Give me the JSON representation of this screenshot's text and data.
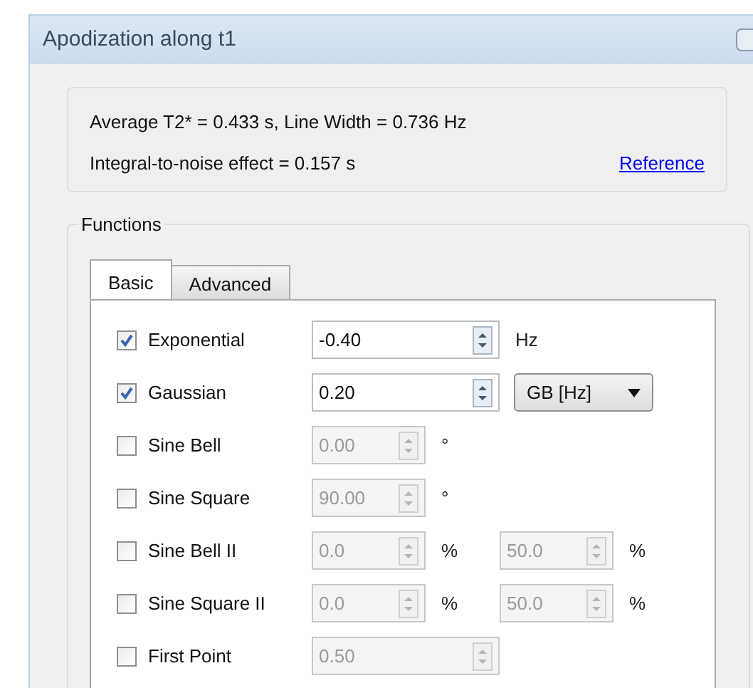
{
  "window": {
    "title": "Apodization along t1"
  },
  "info": {
    "line_1": "Average T2* = 0.433 s, Line Width = 0.736 Hz",
    "line_2": "Integral-to-noise effect = 0.157 s",
    "link": "Reference"
  },
  "functions": {
    "title": "Functions",
    "tabs": [
      {
        "label": "Basic",
        "selected": true
      },
      {
        "label": "Advanced",
        "selected": false
      }
    ],
    "rows": [
      {
        "label": "Exponential",
        "checked": true,
        "fields": [
          {
            "kind": "wide",
            "value": "-0.40",
            "disabled": false,
            "unit": "Hz"
          }
        ]
      },
      {
        "label": "Gaussian",
        "checked": true,
        "fields": [
          {
            "kind": "wide",
            "value": "0.20",
            "disabled": false
          }
        ],
        "dropdown": "GB [Hz]"
      },
      {
        "label": "Sine Bell",
        "checked": false,
        "fields": [
          {
            "kind": "narrow",
            "value": "0.00",
            "disabled": true,
            "unit": "°"
          }
        ]
      },
      {
        "label": "Sine Square",
        "checked": false,
        "fields": [
          {
            "kind": "narrow",
            "value": "90.00",
            "disabled": true,
            "unit": "°"
          }
        ]
      },
      {
        "label": "Sine Bell II",
        "checked": false,
        "fields": [
          {
            "kind": "narrow",
            "value": "0.0",
            "disabled": true,
            "unit": "%"
          },
          {
            "kind": "narrow",
            "value": "50.0",
            "disabled": true,
            "unit": "%"
          }
        ]
      },
      {
        "label": "Sine Square II",
        "checked": false,
        "fields": [
          {
            "kind": "narrow",
            "value": "0.0",
            "disabled": true,
            "unit": "%"
          },
          {
            "kind": "narrow",
            "value": "50.0",
            "disabled": true,
            "unit": "%"
          }
        ]
      },
      {
        "label": "First Point",
        "checked": false,
        "fields": [
          {
            "kind": "wide",
            "value": "0.50",
            "disabled": true
          }
        ]
      }
    ]
  }
}
